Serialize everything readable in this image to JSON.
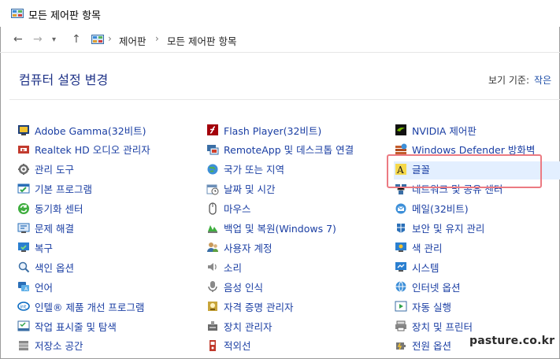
{
  "window": {
    "title": "모든 제어판 항목"
  },
  "address": {
    "crumbs": [
      "제어판",
      "모든 제어판 항목"
    ]
  },
  "content": {
    "heading": "컴퓨터 설정 변경",
    "view_by_label": "보기 기준:",
    "view_by_value": "작은"
  },
  "columns": [
    [
      {
        "label": "Adobe Gamma(32비트)",
        "icon": "adobe-gamma-icon"
      },
      {
        "label": "Realtek HD 오디오 관리자",
        "icon": "realtek-audio-icon"
      },
      {
        "label": "관리 도구",
        "icon": "admin-tools-icon"
      },
      {
        "label": "기본 프로그램",
        "icon": "default-programs-icon"
      },
      {
        "label": "동기화 센터",
        "icon": "sync-center-icon"
      },
      {
        "label": "문제 해결",
        "icon": "troubleshooting-icon"
      },
      {
        "label": "복구",
        "icon": "recovery-icon"
      },
      {
        "label": "색인 옵션",
        "icon": "indexing-options-icon"
      },
      {
        "label": "언어",
        "icon": "language-icon"
      },
      {
        "label": "인텔® 제품 개선 프로그램",
        "icon": "intel-program-icon"
      },
      {
        "label": "작업 표시줄 및 탐색",
        "icon": "taskbar-icon"
      },
      {
        "label": "저장소 공간",
        "icon": "storage-spaces-icon"
      }
    ],
    [
      {
        "label": "Flash Player(32비트)",
        "icon": "flash-player-icon"
      },
      {
        "label": "RemoteApp 및 데스크톱 연결",
        "icon": "remoteapp-icon"
      },
      {
        "label": "국가 또는 지역",
        "icon": "region-icon"
      },
      {
        "label": "날짜 및 시간",
        "icon": "date-time-icon"
      },
      {
        "label": "마우스",
        "icon": "mouse-icon"
      },
      {
        "label": "백업 및 복원(Windows 7)",
        "icon": "backup-restore-icon"
      },
      {
        "label": "사용자 계정",
        "icon": "user-accounts-icon"
      },
      {
        "label": "소리",
        "icon": "sound-icon"
      },
      {
        "label": "음성 인식",
        "icon": "speech-recognition-icon"
      },
      {
        "label": "자격 증명 관리자",
        "icon": "credential-manager-icon"
      },
      {
        "label": "장치 관리자",
        "icon": "device-manager-icon"
      },
      {
        "label": "적외선",
        "icon": "infrared-icon"
      }
    ],
    [
      {
        "label": "NVIDIA 제어판",
        "icon": "nvidia-icon"
      },
      {
        "label": "Windows Defender 방화벽",
        "icon": "firewall-icon"
      },
      {
        "label": "글꼴",
        "icon": "fonts-icon"
      },
      {
        "label": "네트워크 및 공유 센터",
        "icon": "network-center-icon"
      },
      {
        "label": "메일(32비트)",
        "icon": "mail-icon"
      },
      {
        "label": "보안 및 유지 관리",
        "icon": "security-maintenance-icon"
      },
      {
        "label": "색 관리",
        "icon": "color-management-icon"
      },
      {
        "label": "시스템",
        "icon": "system-icon"
      },
      {
        "label": "인터넷 옵션",
        "icon": "internet-options-icon"
      },
      {
        "label": "자동 실행",
        "icon": "autoplay-icon"
      },
      {
        "label": "장치 및 프린터",
        "icon": "devices-printers-icon"
      },
      {
        "label": "전원 옵션",
        "icon": "power-options-icon"
      }
    ]
  ],
  "watermark": "pasture.co.kr",
  "colors": {
    "link": "#1a3ea3",
    "heading": "#1e3287",
    "highlight": "#e3efff",
    "callout": "#ec7a82"
  }
}
